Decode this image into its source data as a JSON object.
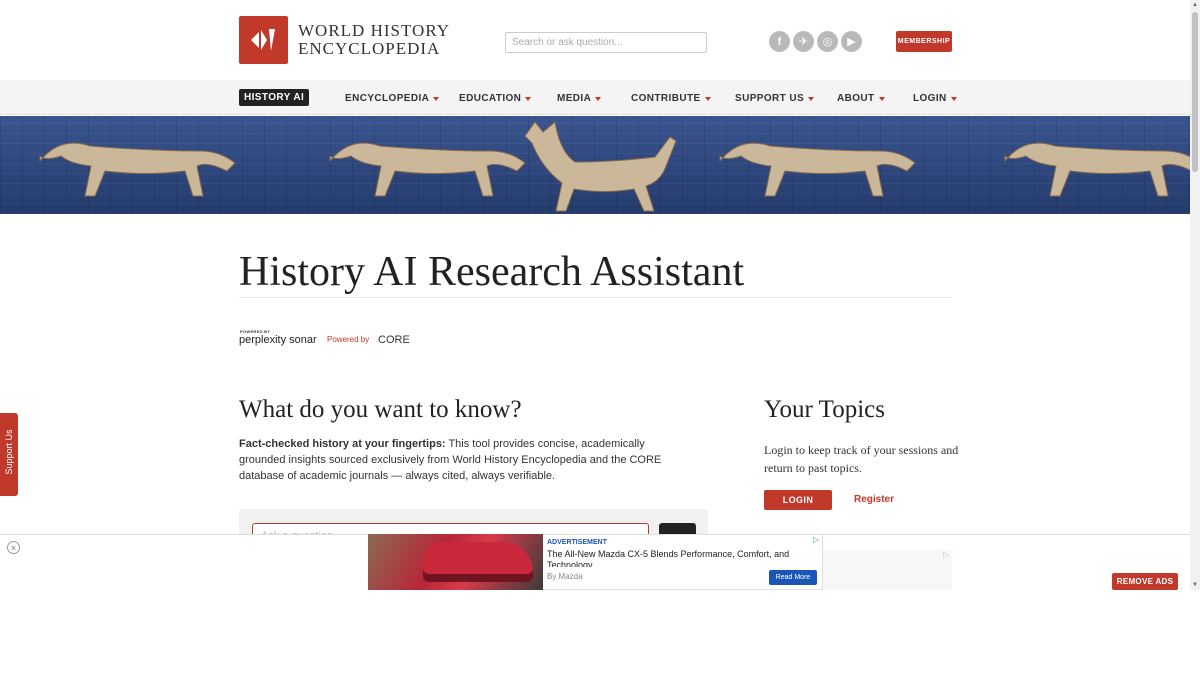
{
  "header": {
    "logo_line1": "WORLD HISTORY",
    "logo_line2": "ENCYCLOPEDIA",
    "search_placeholder": "Search or ask question...",
    "socials": [
      "facebook-icon",
      "bluesky-icon",
      "instagram-icon",
      "youtube-icon"
    ],
    "membership_label": "MEMBERSHIP"
  },
  "nav": {
    "history_ai": "HISTORY AI",
    "items": [
      "ENCYCLOPEDIA",
      "EDUCATION",
      "MEDIA",
      "CONTRIBUTE",
      "SUPPORT US",
      "ABOUT",
      "LOGIN"
    ]
  },
  "main": {
    "title": "History AI Research Assistant",
    "powered_by_small": "POWERED BY",
    "perplexity": "perplexity sonar",
    "core_prefix": "Powered by",
    "core": "CORE",
    "question_heading": "What do you want to know?",
    "desc_bold": "Fact-checked history at your fingertips:",
    "desc_rest": " This tool provides concise, academically grounded insights sourced exclusively from World History Encyclopedia and the CORE database of academic journals — always cited, always verifiable.",
    "ask_placeholder": "Ask a question..."
  },
  "topics": {
    "heading": "Your Topics",
    "text": "Login to keep track of your sessions and return to past topics.",
    "login_label": "LOGIN",
    "register_label": "Register"
  },
  "side_tab": {
    "label": "Support Us"
  },
  "ad": {
    "label": "ADVERTISEMENT",
    "title": "The All-New Mazda CX-5 Blends Performance, Comfort, and Technology",
    "by": "By Mazda",
    "cta": "Read More",
    "close": "×",
    "remove_ads": "REMOVE ADS"
  },
  "colors": {
    "brand_red": "#c0392b",
    "banner_blue": "#2e4a82",
    "ad_blue": "#1a56b8"
  }
}
